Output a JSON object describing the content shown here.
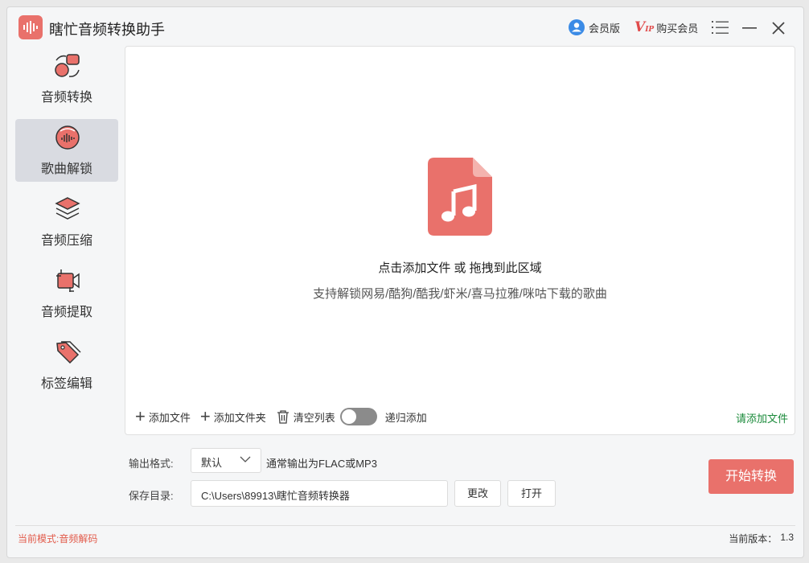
{
  "app": {
    "title": "瞎忙音频转换助手"
  },
  "titlebar": {
    "vip_label": "会员版",
    "buy_label": "购买会员",
    "vip_badge": "V",
    "vip_badge_sub": "IP"
  },
  "sidebar": {
    "items": [
      {
        "label": "音频转换",
        "icon": "audio-convert-icon",
        "active": false
      },
      {
        "label": "歌曲解锁",
        "icon": "song-unlock-icon",
        "active": true
      },
      {
        "label": "音频压缩",
        "icon": "layers-compress-icon",
        "active": false
      },
      {
        "label": "音频提取",
        "icon": "video-extract-icon",
        "active": false
      },
      {
        "label": "标签编辑",
        "icon": "tag-edit-icon",
        "active": false
      }
    ]
  },
  "dropzone": {
    "title": "点击添加文件 或 拖拽到此区域",
    "subtitle": "支持解锁网易/酷狗/酷我/虾米/喜马拉雅/咪咕下载的歌曲",
    "add_file": "添加文件",
    "add_folder": "添加文件夹",
    "clear_list": "清空列表",
    "recursive_add": "递归添加",
    "recursive_enabled": false,
    "status_hint": "请添加文件"
  },
  "settings": {
    "format_label": "输出格式:",
    "format_value": "默认",
    "format_hint": "通常输出为FLAC或MP3",
    "dir_label": "保存目录:",
    "dir_value": "C:\\Users\\89913\\瞎忙音频转换器",
    "change_label": "更改",
    "open_label": "打开",
    "start_label": "开始转换"
  },
  "footer": {
    "mode": "当前模式:音频解码",
    "version_label": "当前版本：",
    "version": "1.3"
  },
  "colors": {
    "accent": "#e9716b",
    "status_green": "#1a8a3a",
    "mode_red": "#e25b4b",
    "vip_blue": "#3b8be6"
  }
}
